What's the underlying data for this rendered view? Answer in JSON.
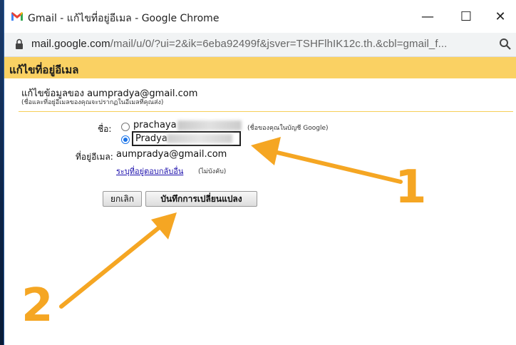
{
  "window": {
    "title": "Gmail - แก้ไขที่อยู่อีเมล - Google Chrome",
    "minimize_glyph": "—",
    "maximize_glyph": "☐",
    "close_glyph": "✕"
  },
  "address_bar": {
    "host": "mail.google.com",
    "path": "/mail/u/0/?ui=2&ik=6eba92499f&jsver=TSHFlhIK12c.th.&cbl=gmail_f..."
  },
  "page": {
    "header_title": "แก้ไขที่อยู่อีเมล",
    "section_title": "แก้ไขข้อมูลของ aumpradya@gmail.com",
    "section_subtitle": "(ชื่อและที่อยู่อีเมลของคุณจะปรากฏในอีเมลที่คุณส่ง)",
    "name_label": "ชื่อ:",
    "option1_name": "prachaya",
    "option1_note": "(ชื่อของคุณในบัญชี Google)",
    "option2_value": "Pradya",
    "email_label": "ที่อยู่อีเมล:",
    "email_value": "aumpradya@gmail.com",
    "reply_link": "ระบุที่อยู่ตอบกลับอื่น",
    "reply_note": "(ไม่บังคับ)",
    "cancel_button": "ยกเลิก",
    "save_button": "บันทึกการเปลี่ยนแปลง"
  },
  "annotations": {
    "label1": "1",
    "label2": "2",
    "color": "#f5a623"
  },
  "colors": {
    "header_band": "#fad163",
    "link": "#1a0dab",
    "radio_selected": "#1a73e8"
  }
}
